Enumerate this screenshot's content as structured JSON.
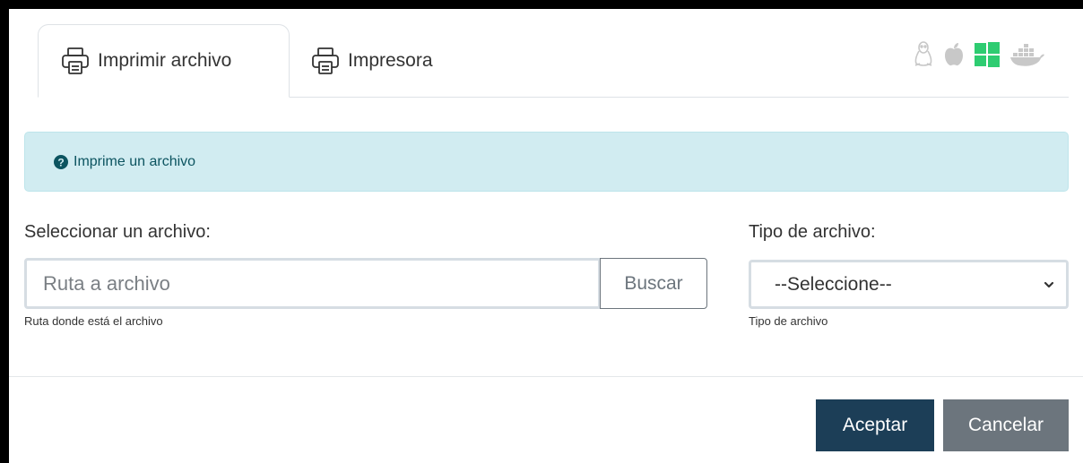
{
  "tabs": [
    {
      "label": "Imprimir archivo",
      "icon": "printer-icon",
      "active": true
    },
    {
      "label": "Impresora",
      "icon": "printer-icon",
      "active": false
    }
  ],
  "os_icons": [
    "linux-icon",
    "apple-icon",
    "windows-icon",
    "docker-icon"
  ],
  "alert": {
    "icon": "question-circle-icon",
    "text": "Imprime un archivo"
  },
  "file": {
    "label": "Seleccionar un archivo:",
    "placeholder": "Ruta a archivo",
    "browse_label": "Buscar",
    "help": "Ruta donde está el archivo"
  },
  "file_type": {
    "label": "Tipo de archivo:",
    "selected": "--Seleccione--",
    "help": "Tipo de archivo"
  },
  "actions": {
    "accept_label": "Aceptar",
    "cancel_label": "Cancelar"
  },
  "colors": {
    "alert_bg": "#d1ecf1",
    "alert_text": "#0c5460",
    "accept_bg": "#1c3e57",
    "cancel_bg": "#6c757d",
    "windows_green": "#2ecc71",
    "os_icon_gray": "#c8c8c8"
  }
}
